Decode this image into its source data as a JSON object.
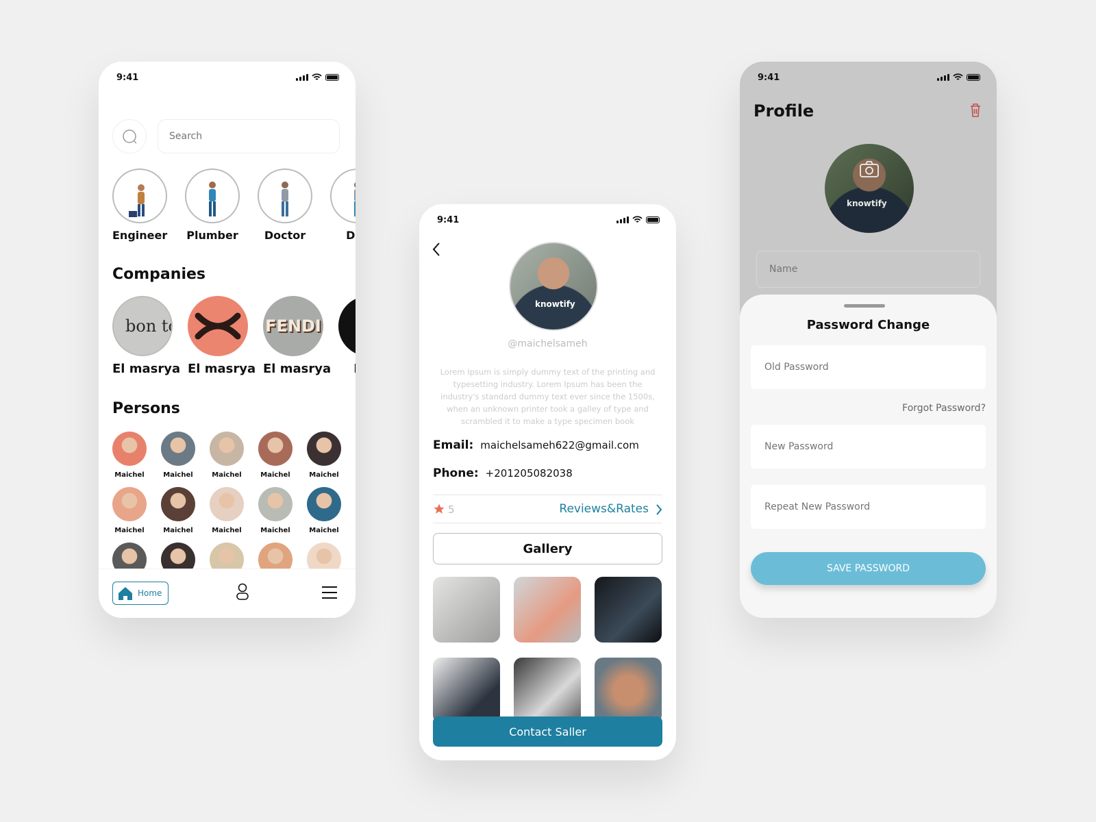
{
  "home_screen": {
    "time": "9:41",
    "search": {
      "placeholder": "Search"
    },
    "categories": [
      {
        "label": "Engineer",
        "icon": "engineer-figure-icon"
      },
      {
        "label": "Plumber",
        "icon": "plumber-figure-icon"
      },
      {
        "label": "Doctor",
        "icon": "doctor-figure-icon"
      },
      {
        "label": "Doc",
        "icon": "doctor-figure-icon"
      }
    ],
    "companies_title": "Companies",
    "companies": [
      {
        "label": "El masrya",
        "logo": "bonton-logo",
        "logo_text": "bon ton"
      },
      {
        "label": "El masrya",
        "logo": "orange-knot-logo",
        "logo_text": ""
      },
      {
        "label": "El masrya",
        "logo": "fendi-logo",
        "logo_text": "FENDI"
      },
      {
        "label": "El m",
        "logo": "black-circle-logo",
        "logo_text": ""
      }
    ],
    "persons_title": "Persons",
    "persons": [
      {
        "name": "Maichel",
        "color": "#e8816b"
      },
      {
        "name": "Maichel",
        "color": "#6b7a84"
      },
      {
        "name": "Maichel",
        "color": "#c8b6a4"
      },
      {
        "name": "Maichel",
        "color": "#a86b5a"
      },
      {
        "name": "Maichel",
        "color": "#3b3133"
      },
      {
        "name": "Maichel",
        "color": "#e8a58a"
      },
      {
        "name": "Maichel",
        "color": "#5a4036"
      },
      {
        "name": "Maichel",
        "color": "#e6d0c2"
      },
      {
        "name": "Maichel",
        "color": "#b9bcb4"
      },
      {
        "name": "Maichel",
        "color": "#2f6a8a"
      },
      {
        "name": "",
        "color": "#5a5a5a"
      },
      {
        "name": "",
        "color": "#3a3030"
      },
      {
        "name": "",
        "color": "#d8c6a8"
      },
      {
        "name": "",
        "color": "#e0a47e"
      },
      {
        "name": "",
        "color": "#f0d8c6"
      }
    ],
    "nav": {
      "home_label": "Home"
    }
  },
  "profile_screen": {
    "time": "9:41",
    "handle": "@maichelsameh",
    "brand_on_shirt": "knowtify",
    "description": "Lorem Ipsum is simply dummy text of the printing and typesetting industry. Lorem Ipsum has been the industry's standard dummy text ever since the 1500s, when an unknown printer took a galley of type and scrambled it to make a type specimen book",
    "email_label": "Email:",
    "email": "maichelsameh622@gmail.com",
    "phone_label": "Phone:",
    "phone": "+201205082038",
    "rating": "5",
    "reviews_link": "Reviews&Rates",
    "gallery_label": "Gallery",
    "contact_label": "Contact Saller",
    "accent": "#1e7fa0"
  },
  "edit_screen": {
    "time": "9:41",
    "title": "Profile",
    "brand_on_shirt": "knowtify",
    "name_placeholder": "Name",
    "sheet_title": "Password Change",
    "old_password_placeholder": "Old Password",
    "forgot_label": "Forgot Password?",
    "new_password_placeholder": "New Password",
    "repeat_password_placeholder": "Repeat New Password",
    "save_label": "SAVE PASSWORD",
    "save_color": "#6bbdd7",
    "trash_color": "#c0504d"
  }
}
